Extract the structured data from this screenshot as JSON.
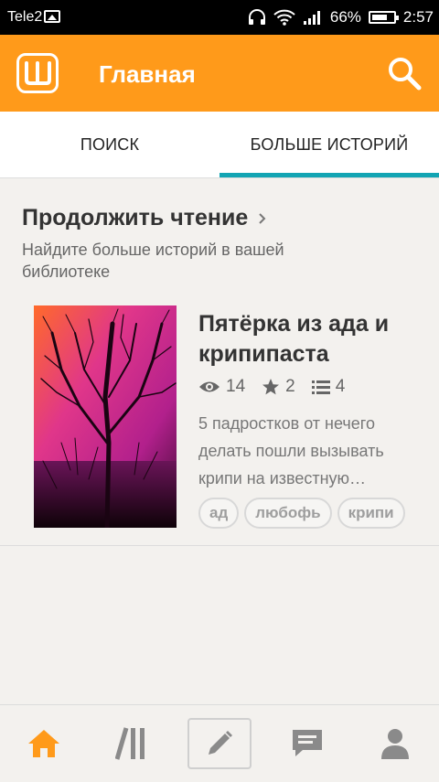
{
  "status_bar": {
    "carrier": "Tele2",
    "battery": "66%",
    "time": "2:57",
    "icons": [
      "gallery-icon",
      "headphones-icon",
      "wifi-icon",
      "signal-icon",
      "battery-icon"
    ]
  },
  "app_bar": {
    "title": "Главная",
    "logo_icon": "wattpad-logo-icon",
    "search_icon": "search-icon"
  },
  "tabs": [
    {
      "label": "ПОИСК",
      "active": false
    },
    {
      "label": "БОЛЬШЕ ИСТОРИЙ",
      "active": true
    }
  ],
  "section": {
    "title": "Продолжить чтение",
    "subtitle": "Найдите больше историй в вашей библиотеке"
  },
  "story": {
    "title": "Пятёрка из ада и крипипаста",
    "views": "14",
    "votes": "2",
    "parts": "4",
    "description": "5 падростков от нечего делать пошли вызывать крипи на известную…",
    "tags": [
      "ад",
      "любофь",
      "крипи"
    ]
  },
  "bottom_nav": [
    {
      "name": "home-icon",
      "active": true
    },
    {
      "name": "library-icon",
      "active": false
    },
    {
      "name": "write-icon",
      "active": false
    },
    {
      "name": "messages-icon",
      "active": false
    },
    {
      "name": "profile-icon",
      "active": false
    }
  ],
  "colors": {
    "accent": "#ff9a1a",
    "tab_indicator": "#12a4b3",
    "background": "#f3f1ee"
  }
}
